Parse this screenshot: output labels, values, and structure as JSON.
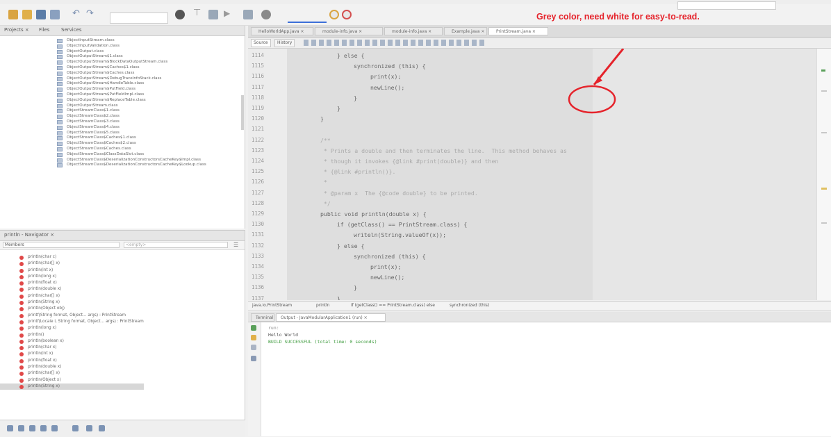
{
  "annotation": {
    "text": "Grey color, need white for easy-to-read.",
    "color": "#e5232b"
  },
  "toolbar": {
    "icons": [
      "new-file-icon",
      "new-project-icon",
      "save-all-icon",
      "open-icon",
      "undo-icon",
      "redo-icon",
      "web-icon",
      "filter-icon",
      "clean-build-icon",
      "run-icon",
      "debug-icon",
      "profile-icon"
    ]
  },
  "projects_pane": {
    "tabs": [
      "Projects ×",
      "Files",
      "Services"
    ],
    "files": [
      "ObjectInputStream.class",
      "ObjectInputValidation.class",
      "ObjectOutput.class",
      "ObjectOutputStream$1.class",
      "ObjectOutputStream$BlockDataOutputStream.class",
      "ObjectOutputStream$Caches$1.class",
      "ObjectOutputStream$Caches.class",
      "ObjectOutputStream$DebugTraceInfoStack.class",
      "ObjectOutputStream$HandleTable.class",
      "ObjectOutputStream$PutField.class",
      "ObjectOutputStream$PutFieldImpl.class",
      "ObjectOutputStream$ReplaceTable.class",
      "ObjectOutputStream.class",
      "ObjectStreamClass$1.class",
      "ObjectStreamClass$2.class",
      "ObjectStreamClass$3.class",
      "ObjectStreamClass$4.class",
      "ObjectStreamClass$5.class",
      "ObjectStreamClass$Caches$1.class",
      "ObjectStreamClass$Caches$2.class",
      "ObjectStreamClass$Caches.class",
      "ObjectStreamClass$ClassDataSlot.class",
      "ObjectStreamClass$DeserializationConstructorsCacheKey$Impl.class",
      "ObjectStreamClass$DeserializationConstructorsCacheKey$Lookup.class"
    ]
  },
  "navigator": {
    "tab": "println - Navigator ×",
    "members_label": "Members",
    "filter_placeholder": "<empty>",
    "members": [
      "println(char c)",
      "println(char[] x)",
      "println(int x)",
      "println(long x)",
      "println(float x)",
      "println(double x)",
      "println(char[] x)",
      "println(String x)",
      "println(Object obj)",
      "printf(String format, Object... args) : PrintStream",
      "printf(Locale l, String format, Object... args) : PrintStream",
      "println(long x)",
      "println()",
      "println(boolean x)",
      "println(char x)",
      "println(int x)",
      "println(float x)",
      "println(double x)",
      "println(char[] x)",
      "println(Object x)",
      "println(String x)"
    ],
    "selected_index": 20
  },
  "editor": {
    "tabs": [
      "HelloWorldApp.java ×",
      "module-info.java ×",
      "module-info.java ×",
      "Example.java ×",
      "PrintStream.java ×"
    ],
    "active_tab": 4,
    "source_label": "Source",
    "history_label": "History",
    "lines": [
      {
        "n": "1114",
        "indent": 2,
        "text": "} else {"
      },
      {
        "n": "1115",
        "indent": 3,
        "text": "synchronized (this) {"
      },
      {
        "n": "1116",
        "indent": 4,
        "text": "print(x);"
      },
      {
        "n": "1117",
        "indent": 4,
        "text": "newLine();"
      },
      {
        "n": "1118",
        "indent": 3,
        "text": "}"
      },
      {
        "n": "1119",
        "indent": 2,
        "text": "}"
      },
      {
        "n": "1120",
        "indent": 1,
        "text": "}"
      },
      {
        "n": "1121",
        "indent": 0,
        "text": ""
      },
      {
        "n": "1122",
        "indent": 1,
        "text": "/**",
        "comment": true
      },
      {
        "n": "1123",
        "indent": 1,
        "text": " * Prints a double and then terminates the line.  This method behaves as",
        "comment": true
      },
      {
        "n": "1124",
        "indent": 1,
        "text": " * though it invokes {@link #print(double)} and then",
        "comment": true
      },
      {
        "n": "1125",
        "indent": 1,
        "text": " * {@link #println()}.",
        "comment": true
      },
      {
        "n": "1126",
        "indent": 1,
        "text": " *",
        "comment": true
      },
      {
        "n": "1127",
        "indent": 1,
        "text": " * @param x  The {@code double} to be printed.",
        "comment": true
      },
      {
        "n": "1128",
        "indent": 1,
        "text": " */",
        "comment": true
      },
      {
        "n": "1129",
        "indent": 1,
        "text": "public void println(double x) {"
      },
      {
        "n": "1130",
        "indent": 2,
        "text": "if (getClass() == PrintStream.class) {"
      },
      {
        "n": "1131",
        "indent": 3,
        "text": "writeln(String.valueOf(x));"
      },
      {
        "n": "1132",
        "indent": 2,
        "text": "} else {"
      },
      {
        "n": "1133",
        "indent": 3,
        "text": "synchronized (this) {"
      },
      {
        "n": "1134",
        "indent": 4,
        "text": "print(x);"
      },
      {
        "n": "1135",
        "indent": 4,
        "text": "newLine();"
      },
      {
        "n": "1136",
        "indent": 3,
        "text": "}"
      },
      {
        "n": "1137",
        "indent": 2,
        "text": "}"
      }
    ],
    "breadcrumb": [
      "java.io.PrintStream",
      "println",
      "if (getClass() == PrintStream.class) else",
      "synchronized (this)"
    ]
  },
  "output": {
    "tabs": [
      "Terminal",
      "Output - JavaModularApplication1 (run) ×"
    ],
    "lines": [
      {
        "text": "run:",
        "color": "#888888"
      },
      {
        "text": "Hello World",
        "color": "#555555"
      },
      {
        "text": "BUILD SUCCESSFUL (total time: 0 seconds)",
        "color": "#3c9a3c"
      }
    ]
  }
}
